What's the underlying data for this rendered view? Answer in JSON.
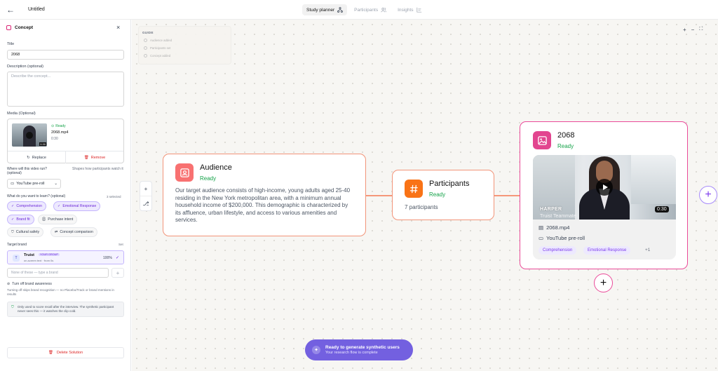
{
  "topbar": {
    "back_icon": "arrow-left-icon",
    "doc_title": "Untitled",
    "tabs": [
      {
        "label": "Study planner",
        "icon": "workflow-icon",
        "active": true
      },
      {
        "label": "Participants",
        "icon": "users-icon",
        "active": false
      },
      {
        "label": "Insights",
        "icon": "chart-icon",
        "active": false
      }
    ]
  },
  "panel": {
    "header": "Concept",
    "title_label": "Title",
    "title_value": "2068",
    "desc_label": "Description (optional)",
    "desc_placeholder": "Describe the concept...",
    "media_label": "Media (Optional)",
    "media": {
      "status": "Ready",
      "filename": "2068.mp4",
      "duration": "0:30",
      "thumb_duration": "0:30",
      "replace_label": "Replace",
      "remove_label": "Remove"
    },
    "where_label": "Where will this video run? (optional)",
    "where_hint": "Shapes how participants watch it",
    "where_value": "YouTube pre-roll",
    "learn_label": "What do you want to learn? (optional)",
    "learn_count": "3 selected",
    "learn_chips": [
      {
        "label": "Comprehension",
        "selected": true
      },
      {
        "label": "Emotional Response",
        "selected": true
      },
      {
        "label": "Brand fit",
        "selected": true
      },
      {
        "label": "Purchase intent",
        "selected": false
      },
      {
        "label": "Cultural safety",
        "selected": false
      },
      {
        "label": "Concept comparison",
        "selected": false
      }
    ],
    "target_brand_label": "Target brand",
    "target_brand_action": "Set",
    "brand": {
      "initial": "T",
      "name": "Truist",
      "tag": "YOUR GROUP",
      "sub": "on-screen text · from 0s",
      "pct": "100%"
    },
    "brand_input_placeholder": "None of these — type a brand",
    "awareness_label": "Turn off brand awareness",
    "awareness_hint": "Turning off skips brand recognition — no Placebo/Track or brand mentions in results",
    "notice": "Only used to score recall after the interview. The synthetic participant never sees this — it watches the clip cold.",
    "delete_label": "Delete Solution"
  },
  "canvas": {
    "guide": {
      "title": "GUIDE",
      "items": [
        "Audience added",
        "Participants set",
        "Concept added"
      ]
    },
    "zoom_controls": [
      "+",
      "−",
      "⛶"
    ],
    "tools": [
      "+",
      "⎇"
    ],
    "audience": {
      "title": "Audience",
      "status": "Ready",
      "description": "Our target audience consists of high-income, young adults aged 25-40 residing in the New York metropolitan area, with a minimum annual household income of $200,000. This demographic is characterized by its affluence, urban lifestyle, and access to various amenities and services."
    },
    "participants": {
      "title": "Participants",
      "status": "Ready",
      "count": "7 participants"
    },
    "concept": {
      "title": "2068",
      "status": "Ready",
      "video_caption_name": "HARPER",
      "video_caption_sub": "Truist Teammate",
      "video_duration": "0:30",
      "filename": "2068.mp4",
      "placement": "YouTube pre-roll",
      "chips": [
        "Comprehension",
        "Emotional Response"
      ],
      "more": "+1"
    },
    "cta": {
      "title": "Ready to generate synthetic users",
      "subtitle": "Your research flow is complete"
    }
  },
  "colors": {
    "accent_orange": "#f97316",
    "accent_pink": "#ec4899",
    "accent_purple": "#7360e0",
    "ready_green": "#16a34a"
  }
}
